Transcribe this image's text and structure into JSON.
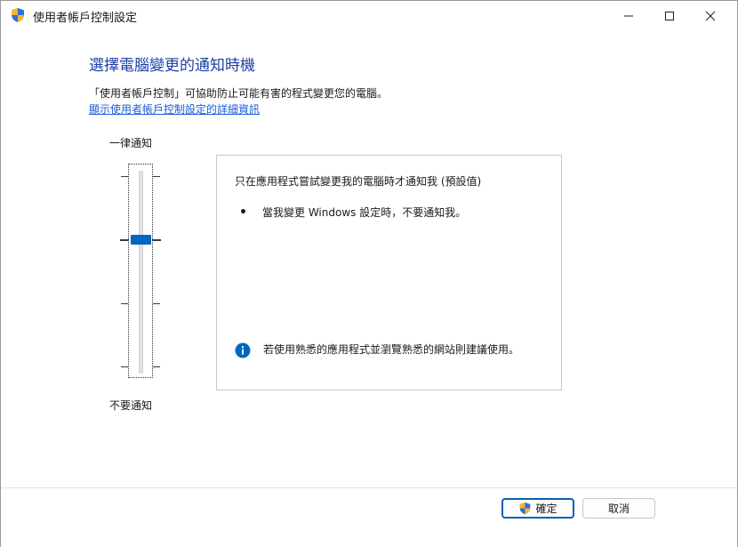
{
  "window": {
    "title": "使用者帳戶控制設定",
    "shield_icon": "uac-shield-icon",
    "controls": {
      "minimize_icon": "minimize-icon",
      "maximize_icon": "maximize-icon",
      "close_icon": "close-icon"
    }
  },
  "main": {
    "heading": "選擇電腦變更的通知時機",
    "description": "「使用者帳戶控制」可協助防止可能有害的程式變更您的電腦。",
    "link": "顯示使用者帳戶控制設定的詳細資訊"
  },
  "slider": {
    "top_label": "一律通知",
    "bottom_label": "不要通知",
    "levels": 4,
    "selected_level": 3
  },
  "panel": {
    "title": "只在應用程式嘗試變更我的電腦時才通知我 (預設值)",
    "bullet": "當我變更 Windows 設定時，不要通知我。",
    "info_icon": "info-icon",
    "info_text": "若使用熟悉的應用程式並瀏覽熟悉的網站則建議使用。"
  },
  "footer": {
    "ok_label": "確定",
    "cancel_label": "取消"
  },
  "colors": {
    "heading": "#1c3fa6",
    "link": "#1d5bd8",
    "accent": "#0067c0"
  }
}
